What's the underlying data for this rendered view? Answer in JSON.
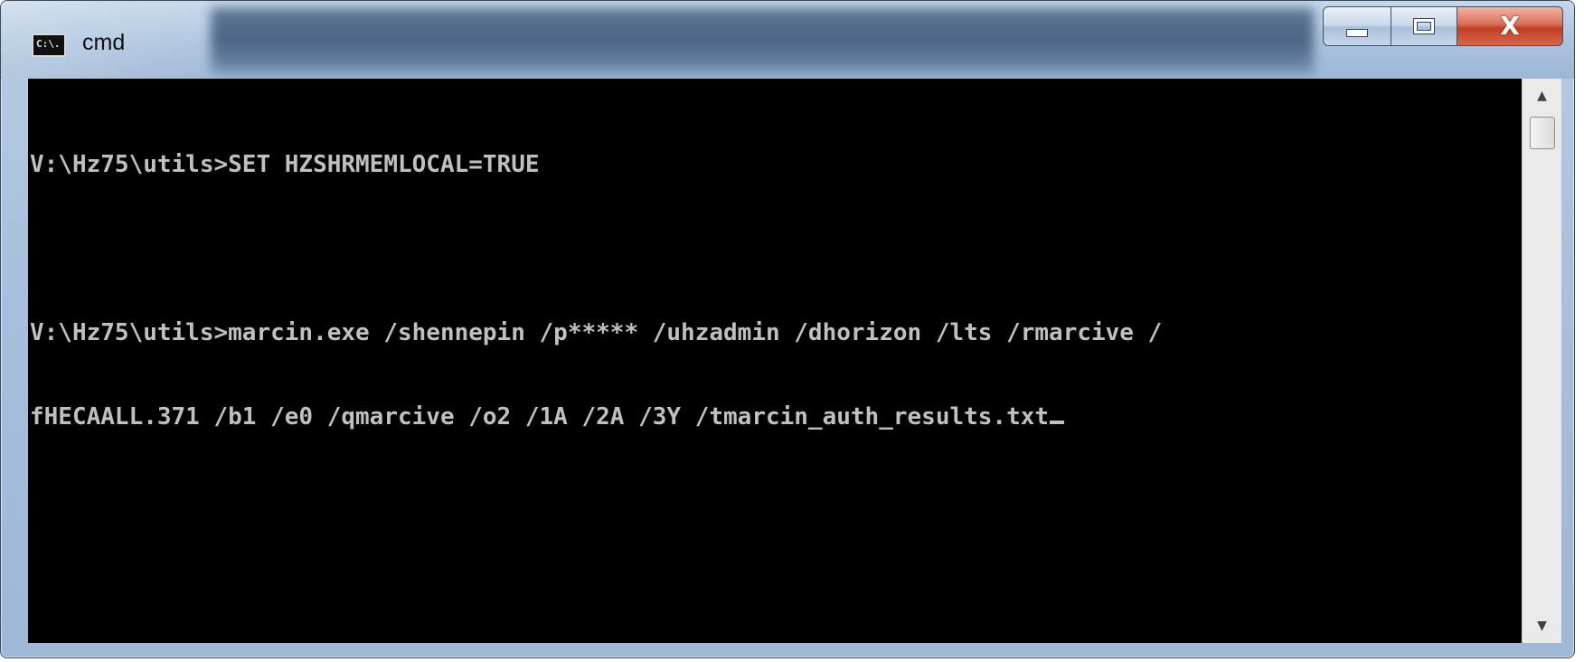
{
  "window": {
    "title": "cmd",
    "icon_label": "C:\\.",
    "controls": {
      "minimize": "minimize-icon",
      "maximize": "maximize-icon",
      "close_glyph": "X"
    }
  },
  "console": {
    "lines": [
      "V:\\Hz75\\utils>SET HZSHRMEMLOCAL=TRUE",
      "",
      "V:\\Hz75\\utils>marcin.exe /shennepin /p***** /uhzadmin /dhorizon /lts /rmarcive /",
      "fHECAALL.371 /b1 /e0 /qmarcive /o2 /1A /2A /3Y /tmarcin_auth_results.txt"
    ],
    "text_color": "#c0c0c0",
    "background": "#000000"
  },
  "scrollbar": {
    "up_arrow": "▲",
    "down_arrow": "▼"
  }
}
